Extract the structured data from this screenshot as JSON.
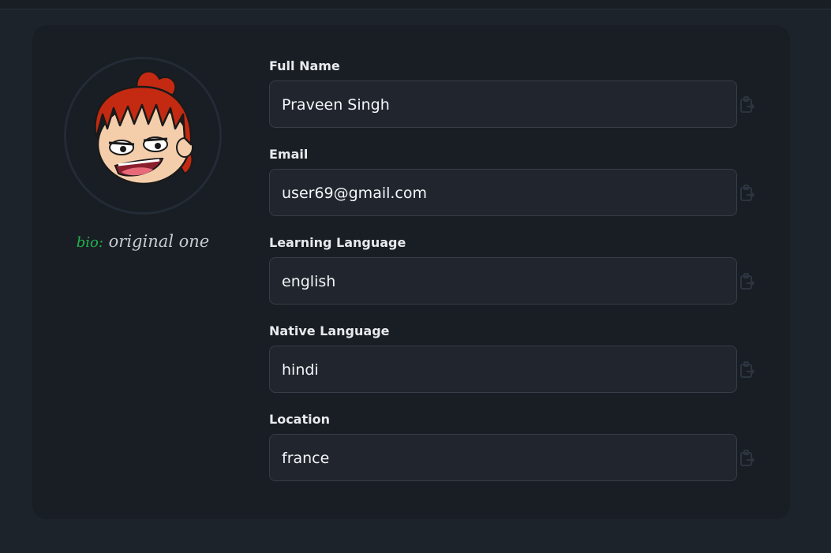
{
  "profile": {
    "bio_key": "bio:",
    "bio_value": "original one"
  },
  "fields": [
    {
      "label": "Full Name",
      "value": "Praveen Singh"
    },
    {
      "label": "Email",
      "value": "user69@gmail.com"
    },
    {
      "label": "Learning Language",
      "value": "english"
    },
    {
      "label": "Native Language",
      "value": "hindi"
    },
    {
      "label": "Location",
      "value": "france"
    }
  ],
  "icons": {
    "avatar": "cartoon-avatar-icon",
    "copy": "clipboard-copy-icon"
  },
  "colors": {
    "background": "#1d232a",
    "card": "#191e24",
    "bio_key": "#23b14d",
    "input_bg": "#20252e"
  }
}
